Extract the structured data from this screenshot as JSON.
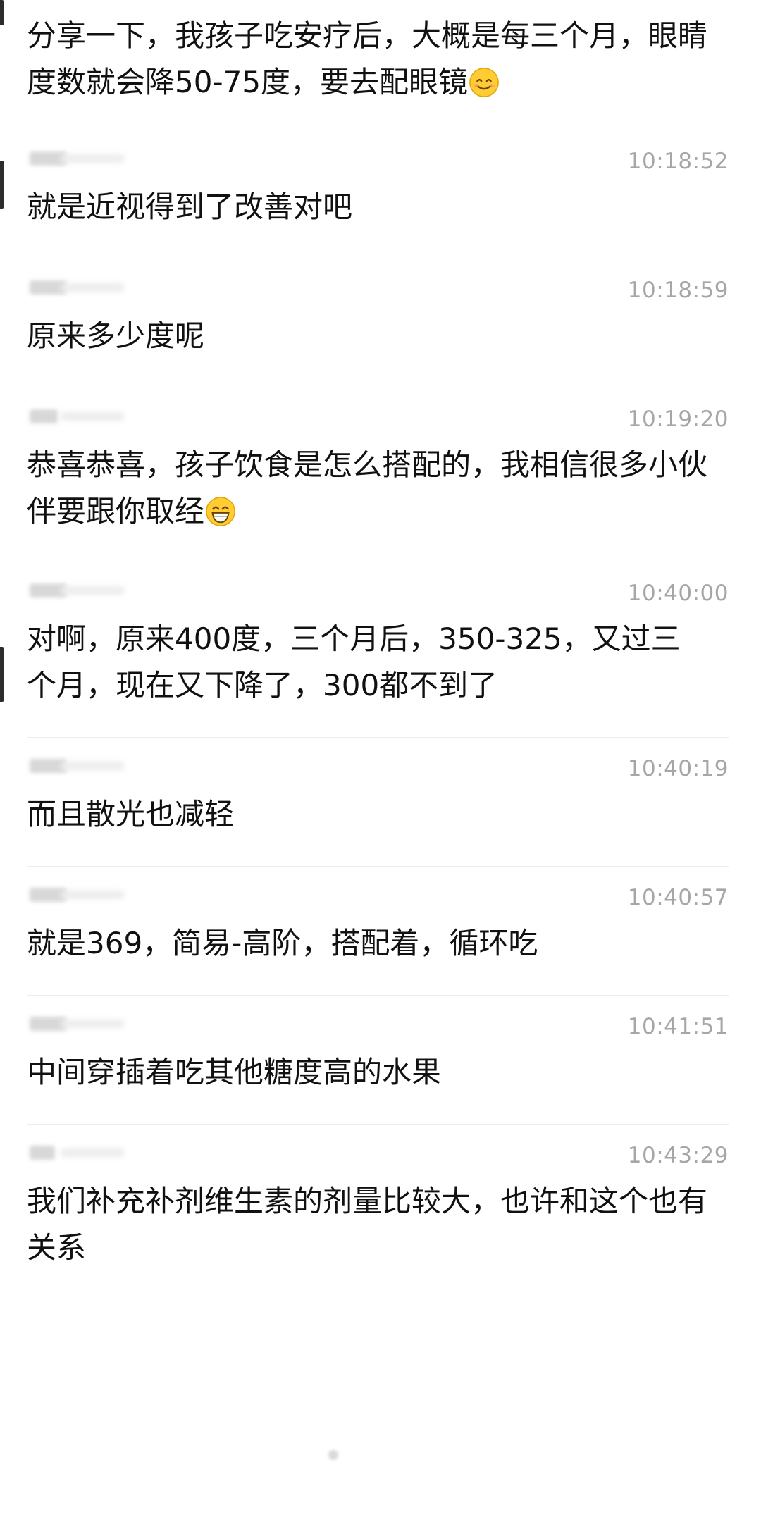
{
  "messages": [
    {
      "time": "",
      "text": "分享一下，我孩子吃安疗后，大概是每三个月，眼睛度数就会降50-75度，要去配眼镜",
      "emoji": "smiling-face-icon"
    },
    {
      "time": "10:18:52",
      "text": "就是近视得到了改善对吧"
    },
    {
      "time": "10:18:59",
      "text": "原来多少度呢"
    },
    {
      "time": "10:19:20",
      "text": "恭喜恭喜，孩子饮食是怎么搭配的，我相信很多小伙伴要跟你取经",
      "emoji": "grinning-face-icon"
    },
    {
      "time": "10:40:00",
      "text": "对啊，原来400度，三个月后，350-325，又过三个月，现在又下降了，300都不到了"
    },
    {
      "time": "10:40:19",
      "text": "而且散光也减轻"
    },
    {
      "time": "10:40:57",
      "text": "就是369，简易-高阶，搭配着，循环吃"
    },
    {
      "time": "10:41:51",
      "text": "中间穿插着吃其他糖度高的水果"
    },
    {
      "time": "10:43:29",
      "text": "我们补充补剂维生素的剂量比较大，也许和这个也有关系"
    }
  ],
  "colors": {
    "text": "#111111",
    "timestamp": "#a6a6a6",
    "divider": "#ececec",
    "emoji_face": "#ffcc33"
  }
}
